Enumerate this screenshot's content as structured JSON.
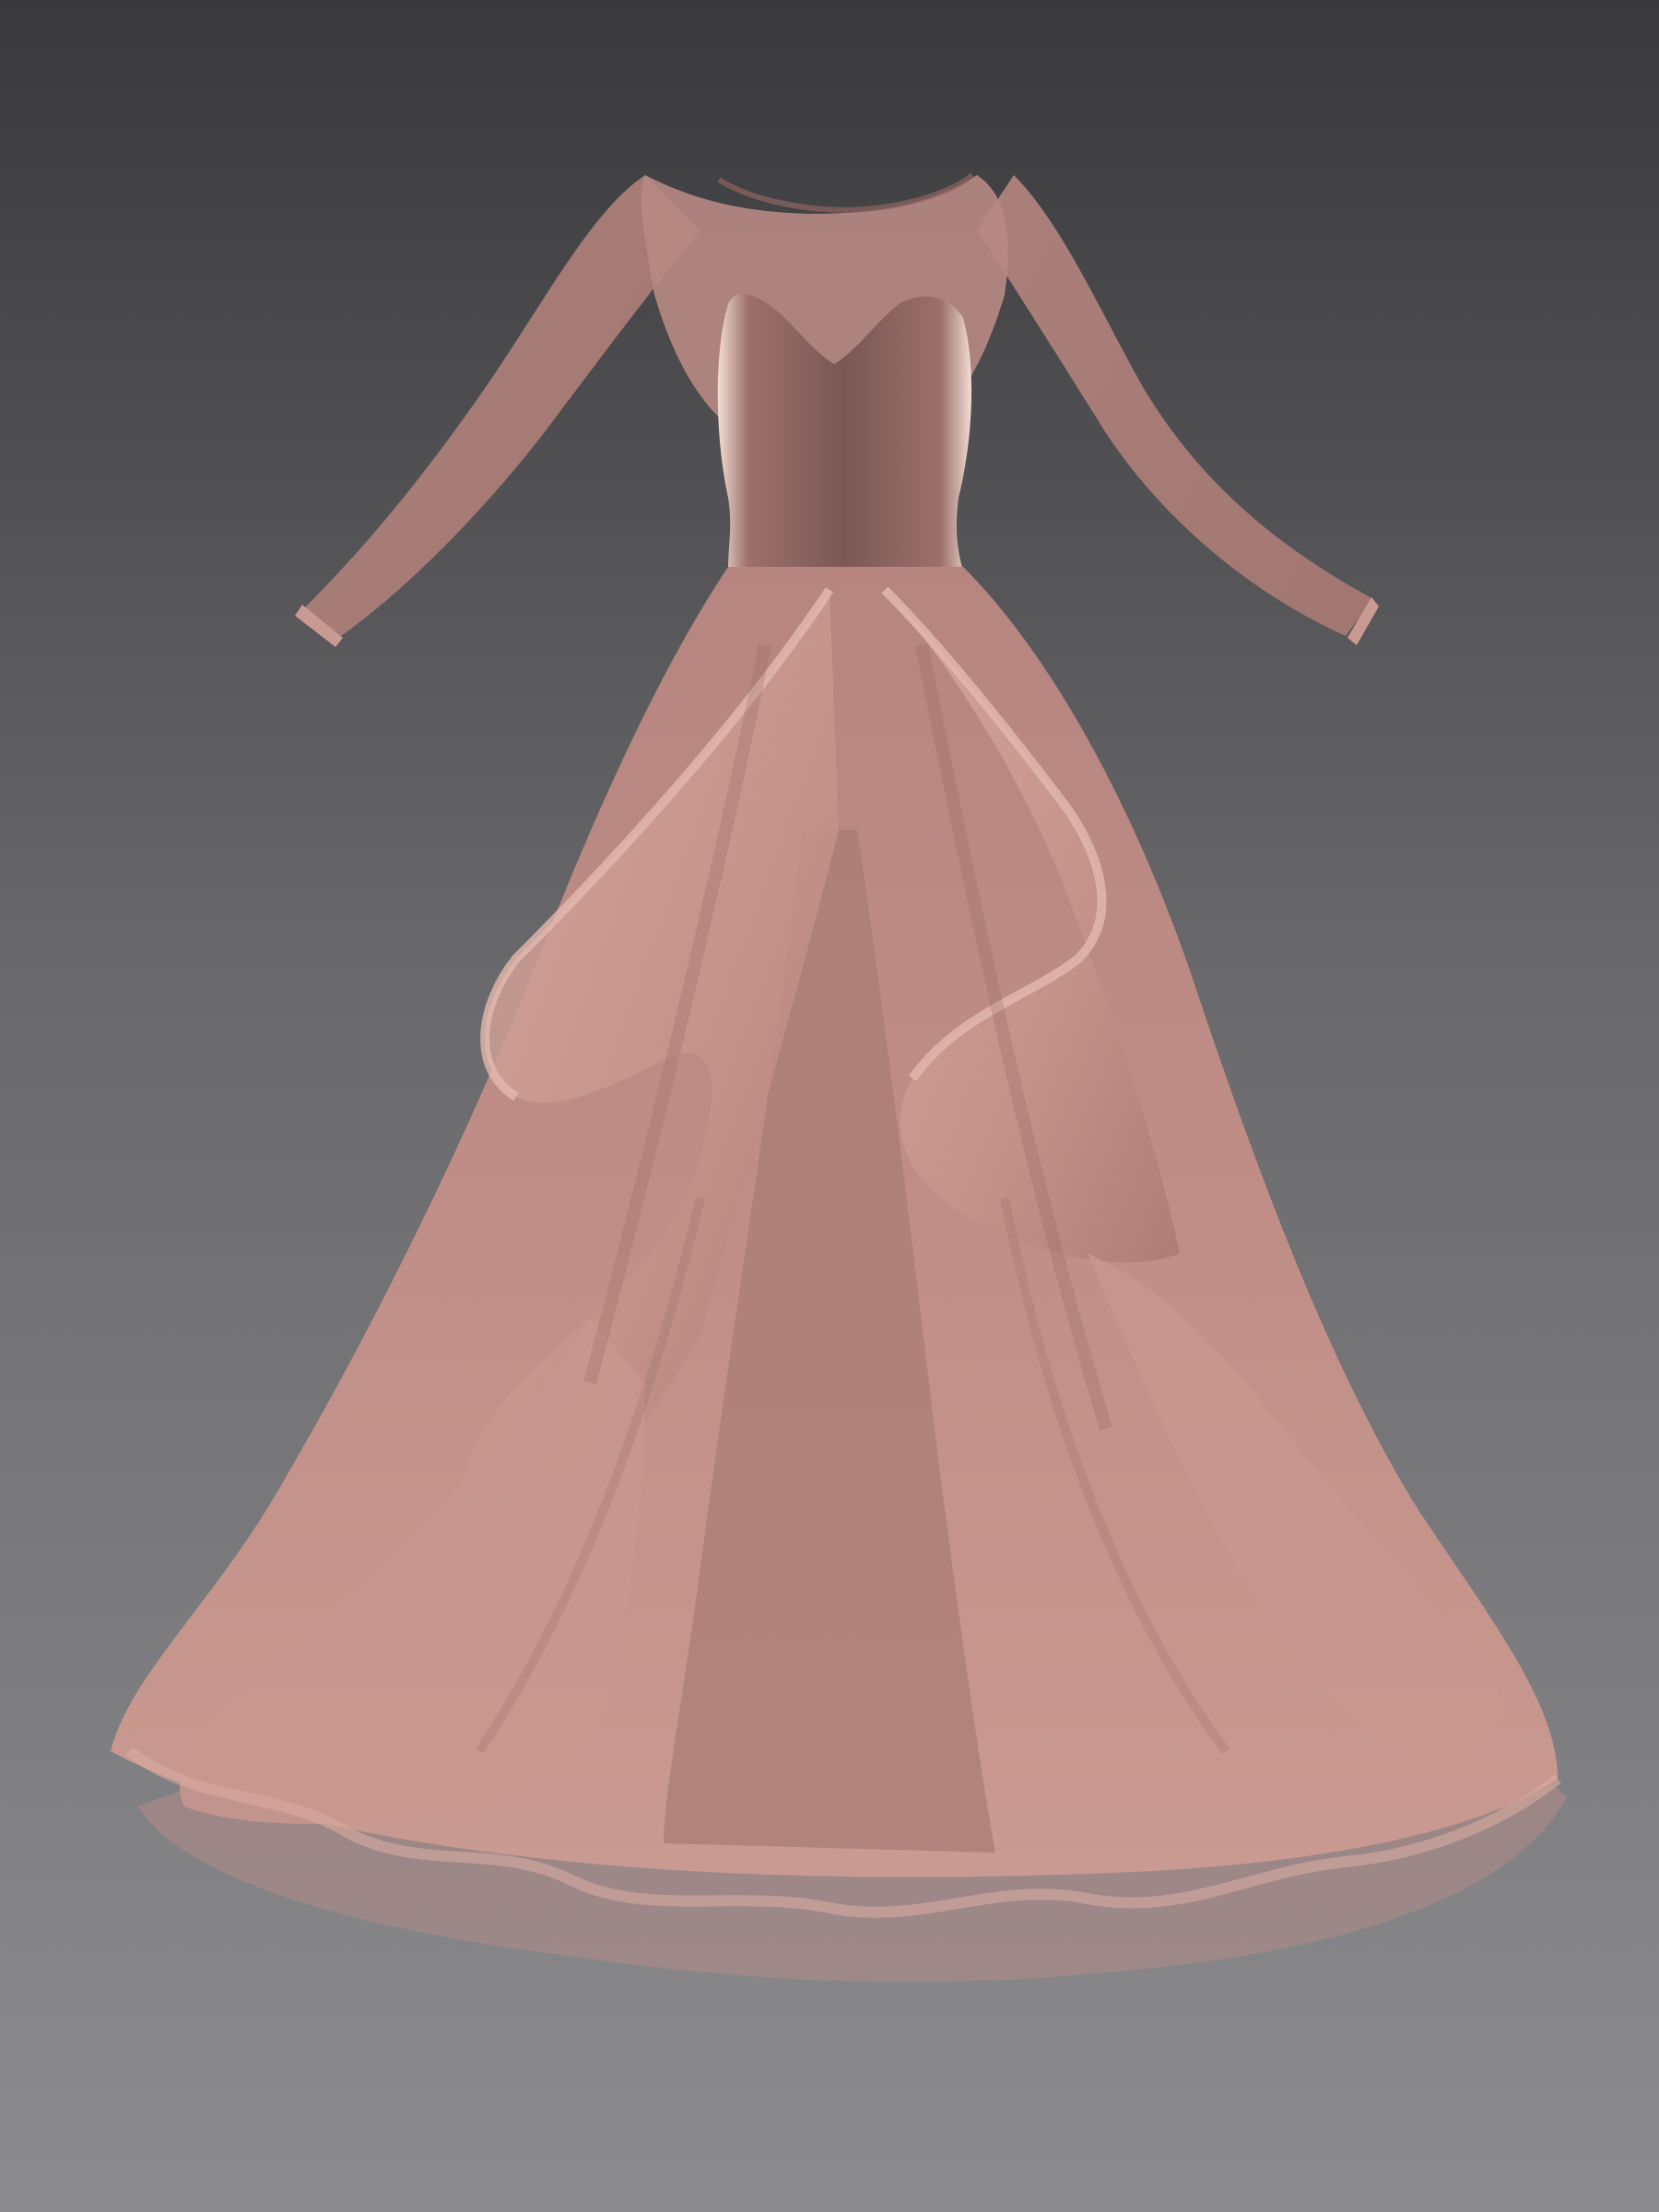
{
  "scene": {
    "subject": "gown-render",
    "colors": {
      "background_top": "#39393c",
      "background_bottom": "#8c8c8f",
      "fabric_base": "#c9958b",
      "fabric_light": "#d6a89e",
      "fabric_shadow": "#8e6460",
      "bodice": "#7d5a57",
      "bodice_highlight": "#f4e0d8",
      "sheer": "#b98a84"
    }
  }
}
